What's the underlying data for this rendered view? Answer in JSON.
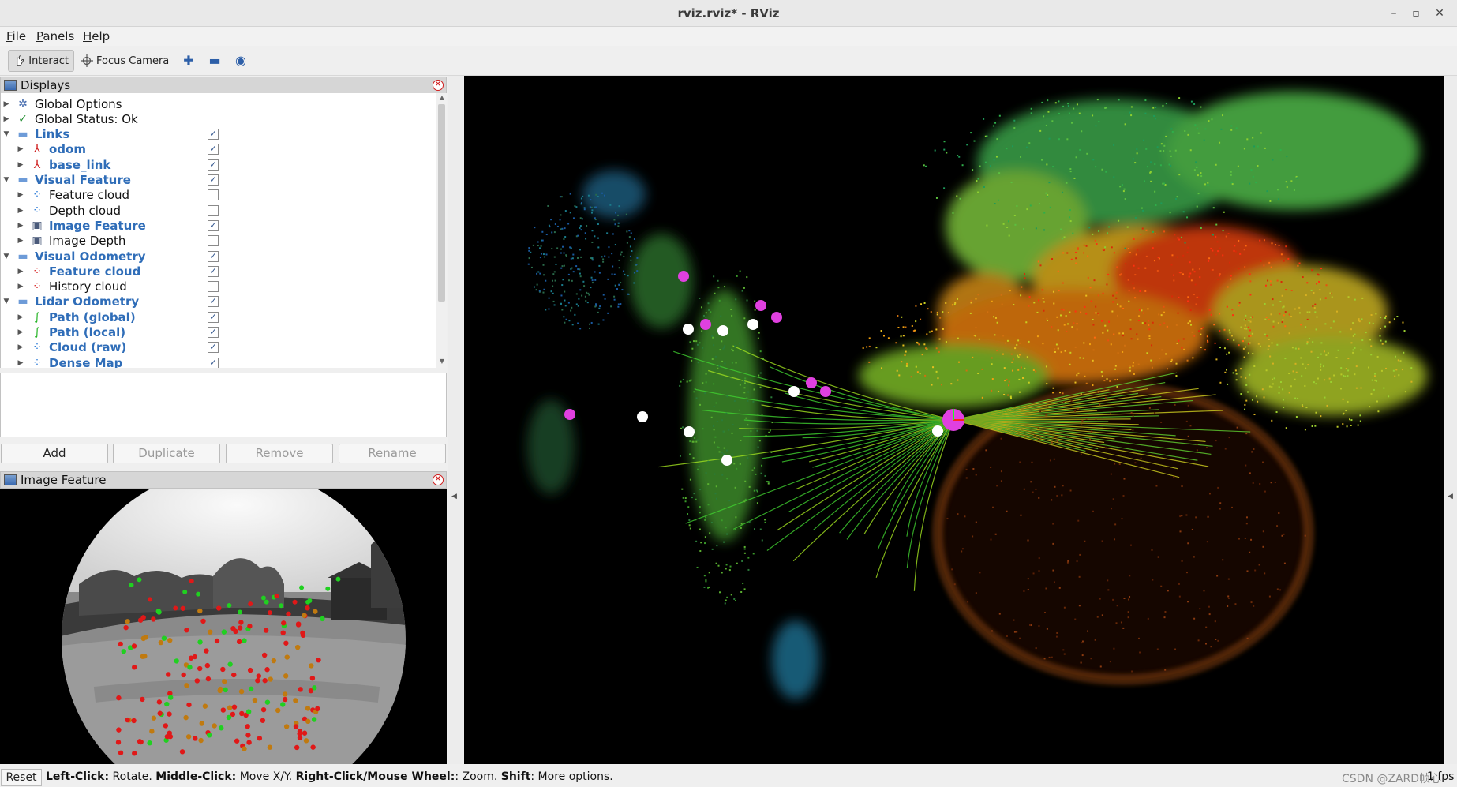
{
  "window": {
    "title": "rviz.rviz* - RViz",
    "minimize": "–",
    "restore": "▫",
    "close": "✕"
  },
  "menu": [
    {
      "first": "F",
      "rest": "ile"
    },
    {
      "first": "P",
      "rest": "anels"
    },
    {
      "first": "H",
      "rest": "elp"
    }
  ],
  "toolbar": {
    "interact_label": "Interact",
    "focus_camera_label": "Focus Camera",
    "add_tool_icon": "plus-icon",
    "remove_tool_icon": "minus-icon",
    "view_tool_icon": "eye-icon"
  },
  "displays_panel": {
    "title": "Displays",
    "rows": [
      {
        "label": "Global Options",
        "icon": "gear-icon",
        "style": "plain",
        "indent": 0,
        "expanded": false,
        "checkbox": null
      },
      {
        "label": "Global Status: Ok",
        "icon": "check-icon",
        "style": "plain",
        "indent": 0,
        "expanded": false,
        "checkbox": null
      },
      {
        "label": "Links",
        "icon": "folder-icon",
        "style": "enabled",
        "indent": 0,
        "expanded": true,
        "checkbox": true
      },
      {
        "label": "odom",
        "icon": "axes-icon",
        "style": "enabled",
        "indent": 1,
        "expanded": false,
        "checkbox": true
      },
      {
        "label": "base_link",
        "icon": "axes-icon",
        "style": "enabled",
        "indent": 1,
        "expanded": false,
        "checkbox": true
      },
      {
        "label": "Visual Feature",
        "icon": "folder-icon",
        "style": "enabled",
        "indent": 0,
        "expanded": true,
        "checkbox": true
      },
      {
        "label": "Feature cloud",
        "icon": "pointcloud-blue-icon",
        "style": "plain",
        "indent": 1,
        "expanded": false,
        "checkbox": false
      },
      {
        "label": "Depth cloud",
        "icon": "pointcloud-blue-icon",
        "style": "plain",
        "indent": 1,
        "expanded": false,
        "checkbox": false
      },
      {
        "label": "Image Feature",
        "icon": "image-icon",
        "style": "enabled",
        "indent": 1,
        "expanded": false,
        "checkbox": true
      },
      {
        "label": "Image Depth",
        "icon": "image-icon",
        "style": "plain",
        "indent": 1,
        "expanded": false,
        "checkbox": false
      },
      {
        "label": "Visual Odometry",
        "icon": "folder-icon",
        "style": "enabled",
        "indent": 0,
        "expanded": true,
        "checkbox": true
      },
      {
        "label": "Feature cloud",
        "icon": "pointcloud-red-icon",
        "style": "enabled",
        "indent": 1,
        "expanded": false,
        "checkbox": true
      },
      {
        "label": "History cloud",
        "icon": "pointcloud-red-icon",
        "style": "plain",
        "indent": 1,
        "expanded": false,
        "checkbox": false
      },
      {
        "label": "Lidar Odometry",
        "icon": "folder-icon",
        "style": "enabled",
        "indent": 0,
        "expanded": true,
        "checkbox": true
      },
      {
        "label": "Path (global)",
        "icon": "path-icon",
        "style": "enabled",
        "indent": 1,
        "expanded": false,
        "checkbox": true
      },
      {
        "label": "Path (local)",
        "icon": "path-icon",
        "style": "enabled",
        "indent": 1,
        "expanded": false,
        "checkbox": true
      },
      {
        "label": "Cloud (raw)",
        "icon": "pointcloud-blue-icon",
        "style": "enabled",
        "indent": 1,
        "expanded": false,
        "checkbox": true
      },
      {
        "label": "Dense Map",
        "icon": "pointcloud-blue-icon",
        "style": "enabled",
        "indent": 1,
        "expanded": false,
        "checkbox": true
      }
    ],
    "buttons": {
      "add": "Add",
      "duplicate": "Duplicate",
      "remove": "Remove",
      "rename": "Rename"
    }
  },
  "image_panel": {
    "title": "Image Feature"
  },
  "status_bar": {
    "reset": "Reset",
    "left_click": "Left-Click:",
    "rotate": " Rotate. ",
    "middle_click": "Middle-Click:",
    "move": " Move X/Y. ",
    "right_click": "Right-Click/Mouse Wheel:",
    "zoom": ": Zoom. ",
    "shift": "Shift",
    "more": ": More options.",
    "watermark": "CSDN @ZARD帧心",
    "fps": "1 fps"
  },
  "colors": {
    "enabled_text": "#2f6db8",
    "view_bg": "#000000",
    "close_red": "#d12020",
    "pose_marker": "#e040e0"
  }
}
